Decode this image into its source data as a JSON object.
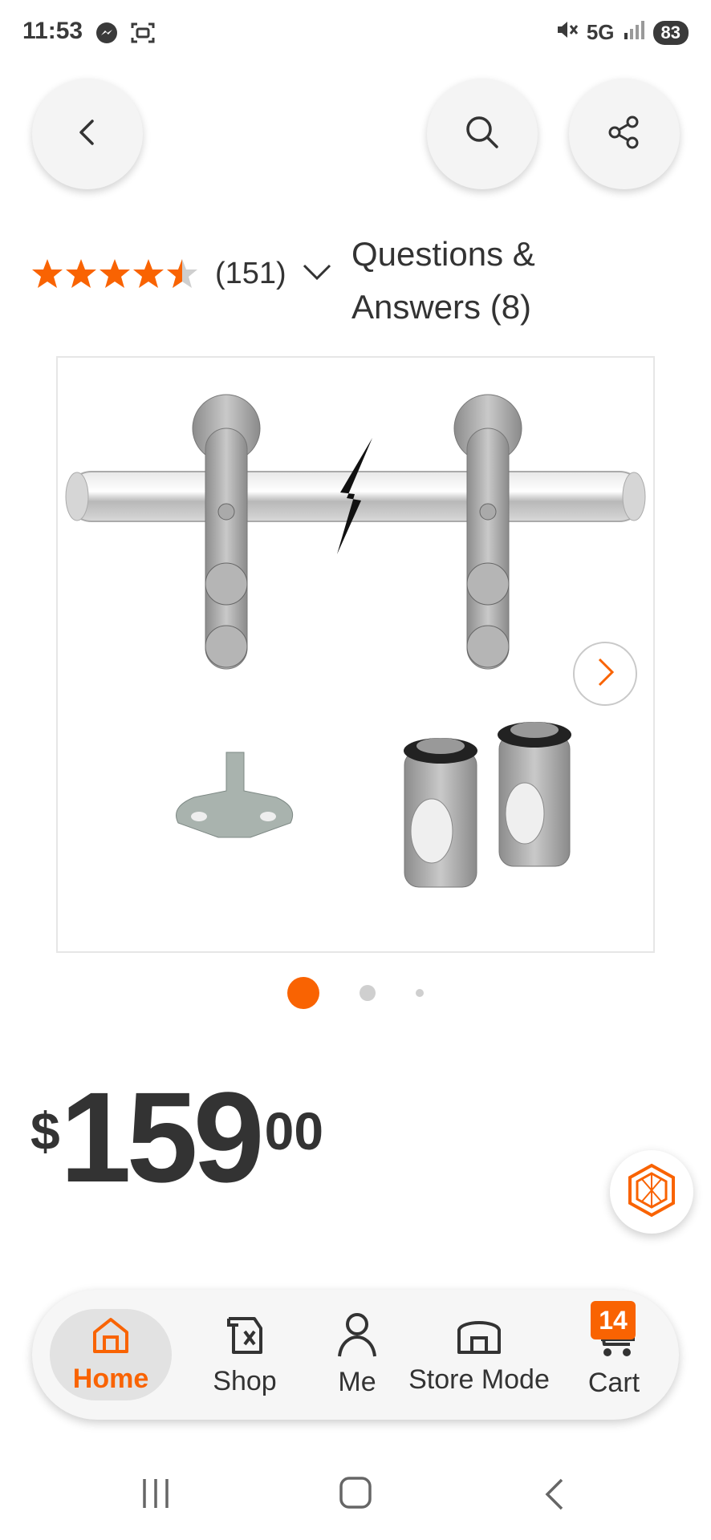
{
  "status_bar": {
    "time": "11:53",
    "left_icons": [
      "messenger-icon",
      "screenshot-icon"
    ],
    "network": "5G",
    "battery": "83"
  },
  "header": {
    "back_icon": "chevron-left-icon",
    "search_icon": "search-icon",
    "share_icon": "share-icon"
  },
  "rating": {
    "stars": 4.5,
    "review_count": "(151)",
    "questions_link": "Questions & Answers (8)"
  },
  "gallery": {
    "image_alt": "Stainless steel barn door hardware kit",
    "active_index": 0,
    "dots": 3
  },
  "price": {
    "symbol": "$",
    "dollars": "159",
    "cents": "00"
  },
  "bottom_nav": {
    "items": [
      {
        "label": "Home",
        "icon": "home-icon",
        "active": true
      },
      {
        "label": "Shop",
        "icon": "shop-icon",
        "active": false
      },
      {
        "label": "Me",
        "icon": "person-icon",
        "active": false
      },
      {
        "label": "Store Mode",
        "icon": "store-icon",
        "active": false
      },
      {
        "label": "Cart",
        "icon": "cart-icon",
        "active": false
      }
    ],
    "cart_badge": "14"
  },
  "colors": {
    "brand_orange": "#f96302",
    "text": "#333333",
    "nav_background": "#f6f6f6"
  }
}
